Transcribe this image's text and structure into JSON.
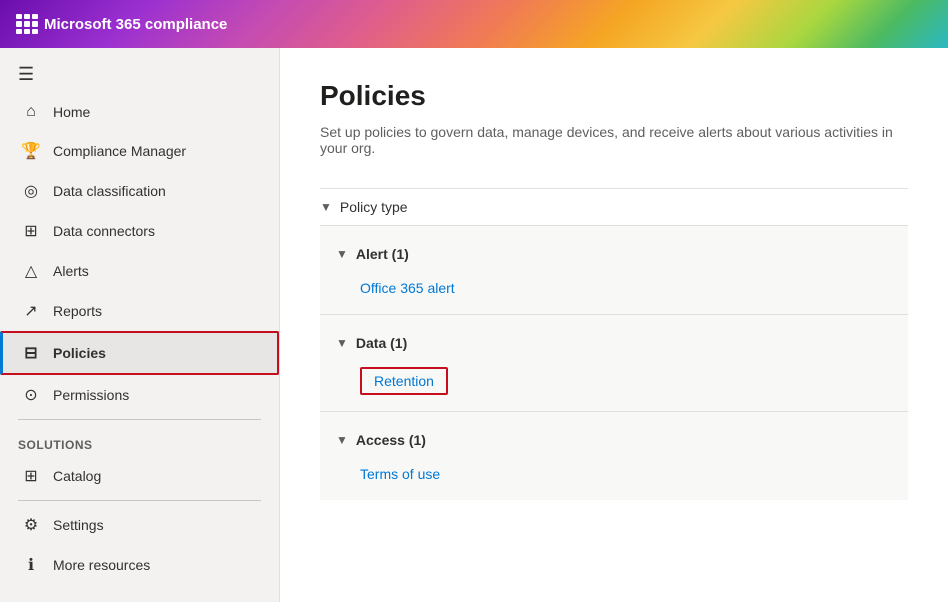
{
  "header": {
    "app_title": "Microsoft 365 compliance",
    "waffle_label": "App launcher"
  },
  "sidebar": {
    "hamburger_label": "☰",
    "nav_items": [
      {
        "id": "home",
        "label": "Home",
        "icon": "⌂",
        "active": false
      },
      {
        "id": "compliance-manager",
        "label": "Compliance Manager",
        "icon": "🏆",
        "active": false
      },
      {
        "id": "data-classification",
        "label": "Data classification",
        "icon": "◎",
        "active": false
      },
      {
        "id": "data-connectors",
        "label": "Data connectors",
        "icon": "⊞",
        "active": false
      },
      {
        "id": "alerts",
        "label": "Alerts",
        "icon": "△",
        "active": false
      },
      {
        "id": "reports",
        "label": "Reports",
        "icon": "↗",
        "active": false
      },
      {
        "id": "policies",
        "label": "Policies",
        "icon": "⊟",
        "active": true
      },
      {
        "id": "permissions",
        "label": "Permissions",
        "icon": "⊙",
        "active": false
      }
    ],
    "solutions_section": "Solutions",
    "solutions_items": [
      {
        "id": "catalog",
        "label": "Catalog",
        "icon": "⊞",
        "active": false
      }
    ],
    "bottom_items": [
      {
        "id": "settings",
        "label": "Settings",
        "icon": "⚙",
        "active": false
      },
      {
        "id": "more-resources",
        "label": "More resources",
        "icon": "ℹ",
        "active": false
      }
    ]
  },
  "main": {
    "title": "Policies",
    "description": "Set up policies to govern data, manage devices, and receive alerts about various activities in your org.",
    "policy_type_label": "Policy type",
    "groups": [
      {
        "id": "alert",
        "label": "Alert (1)",
        "expanded": true,
        "items": [
          {
            "id": "office365-alert",
            "label": "Office 365 alert",
            "highlighted": false
          }
        ]
      },
      {
        "id": "data",
        "label": "Data (1)",
        "expanded": true,
        "items": [
          {
            "id": "retention",
            "label": "Retention",
            "highlighted": true
          }
        ]
      },
      {
        "id": "access",
        "label": "Access (1)",
        "expanded": true,
        "items": [
          {
            "id": "terms-of-use",
            "label": "Terms of use",
            "highlighted": false
          }
        ]
      }
    ]
  }
}
